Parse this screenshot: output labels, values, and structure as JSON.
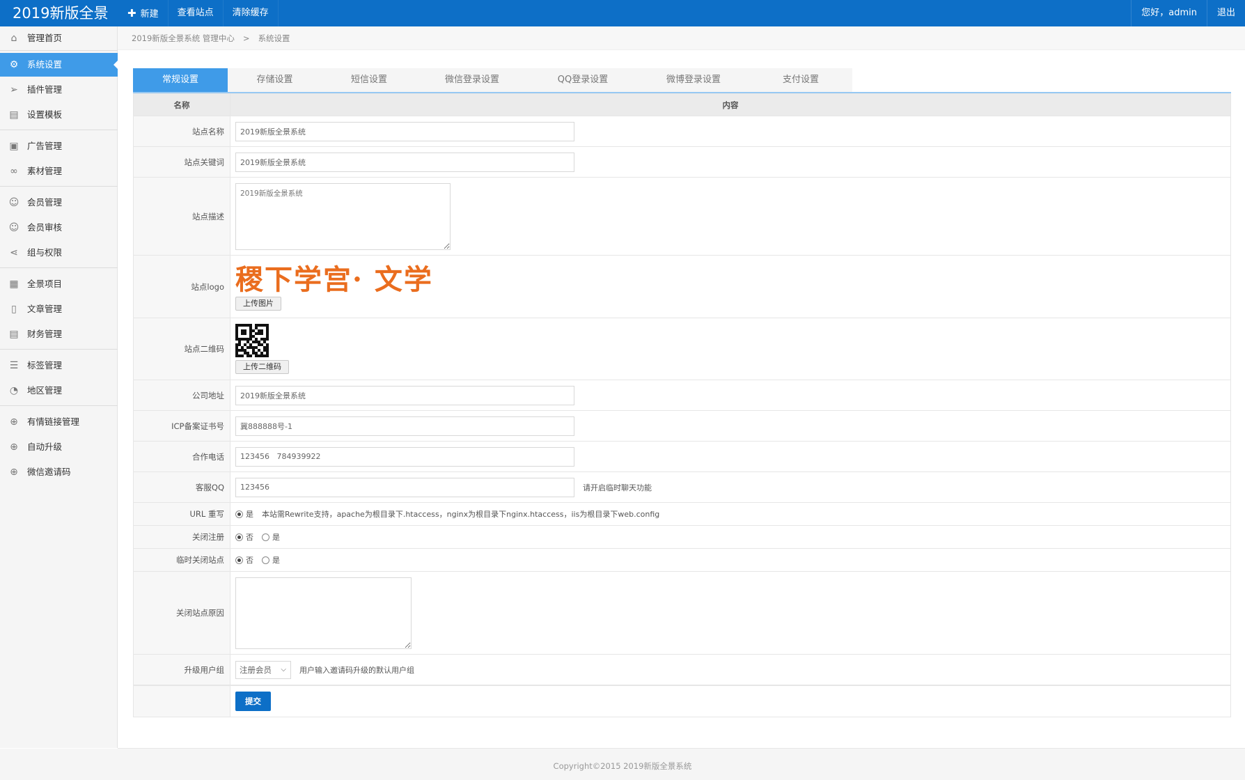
{
  "app": {
    "title": "2019新版全景"
  },
  "topnav": {
    "new_label": "新建",
    "view_site_label": "查看站点",
    "clear_cache_label": "清除缓存",
    "greeting": "您好，admin",
    "logout_label": "退出"
  },
  "sidebar": {
    "items": [
      {
        "label": "管理首页",
        "icon": "home-icon"
      },
      {
        "label": "系统设置",
        "icon": "gear-icon"
      },
      {
        "label": "插件管理",
        "icon": "send-icon"
      },
      {
        "label": "设置模板",
        "icon": "template-icon"
      },
      {
        "label": "广告管理",
        "icon": "image-icon"
      },
      {
        "label": "素材管理",
        "icon": "link-icon"
      },
      {
        "label": "会员管理",
        "icon": "users-icon"
      },
      {
        "label": "会员审核",
        "icon": "user-check-icon"
      },
      {
        "label": "组与权限",
        "icon": "share-icon"
      },
      {
        "label": "全景项目",
        "icon": "grid-icon"
      },
      {
        "label": "文章管理",
        "icon": "file-icon"
      },
      {
        "label": "财务管理",
        "icon": "finance-icon"
      },
      {
        "label": "标签管理",
        "icon": "tag-list-icon"
      },
      {
        "label": "地区管理",
        "icon": "pie-icon"
      },
      {
        "label": "有情链接管理",
        "icon": "download-circle-icon"
      },
      {
        "label": "自动升级",
        "icon": "download-circle-icon"
      },
      {
        "label": "微信邀请码",
        "icon": "download-circle-icon"
      }
    ]
  },
  "breadcrumb": {
    "root": "2019新版全景系统 管理中心",
    "separator": ">",
    "current": "系统设置"
  },
  "tabs": [
    "常规设置",
    "存储设置",
    "短信设置",
    "微信登录设置",
    "QQ登录设置",
    "微博登录设置",
    "支付设置"
  ],
  "table_head": {
    "name": "名称",
    "content": "内容"
  },
  "form": {
    "site_name": {
      "label": "站点名称",
      "value": "2019新版全景系统"
    },
    "site_keywords": {
      "label": "站点关键词",
      "value": "2019新版全景系统"
    },
    "site_desc": {
      "label": "站点描述",
      "value": "2019新版全景系统"
    },
    "site_logo": {
      "label": "站点logo",
      "logo_text": "稷下学宫· 文学",
      "button": "上传图片"
    },
    "site_qr": {
      "label": "站点二维码",
      "button": "上传二维码"
    },
    "company_addr": {
      "label": "公司地址",
      "value": "2019新版全景系统"
    },
    "icp": {
      "label": "ICP备案证书号",
      "value": "冀888888号-1"
    },
    "phone": {
      "label": "合作电话",
      "value": "123456   784939922"
    },
    "qq": {
      "label": "客服QQ",
      "value": "123456",
      "hint": "请开启临时聊天功能"
    },
    "url_rewrite": {
      "label": "URL 重写",
      "option_yes": "是",
      "hint": "本站需Rewrite支持，apache为根目录下.htaccess，nginx为根目录下nginx.htaccess，iis为根目录下web.config"
    },
    "close_register": {
      "label": "关闭注册",
      "option_no": "否",
      "option_yes": "是"
    },
    "temp_close": {
      "label": "临时关闭站点",
      "option_no": "否",
      "option_yes": "是"
    },
    "close_reason": {
      "label": "关闭站点原因",
      "value": ""
    },
    "upgrade_group": {
      "label": "升级用户组",
      "selected": "注册会员",
      "hint": "用户输入邀请码升级的默认用户组"
    },
    "submit_label": "提交"
  },
  "footer": {
    "text": "Copyright©2015    2019新版全景系统"
  },
  "colors": {
    "topbar": "#0d6fc7",
    "active": "#3f9be8",
    "logo": "#ea6d1e"
  }
}
